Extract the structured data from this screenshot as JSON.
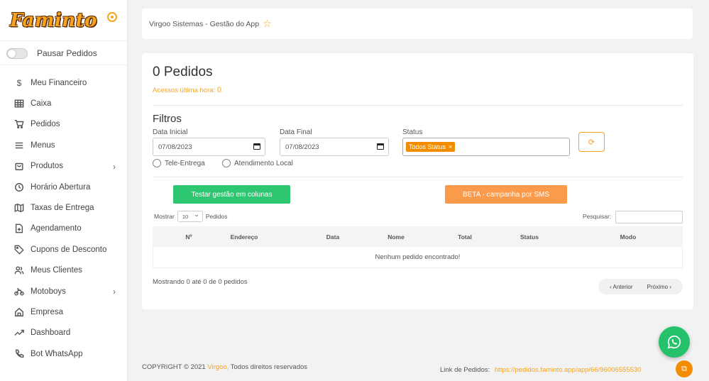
{
  "brand": {
    "logo_text": "Faminto"
  },
  "sidebar": {
    "pause_label": "Pausar Pedidos",
    "items": [
      {
        "label": "Meu Financeiro",
        "icon": "dollar-icon"
      },
      {
        "label": "Caixa",
        "icon": "table-icon"
      },
      {
        "label": "Pedidos",
        "icon": "cart-icon"
      },
      {
        "label": "Menus",
        "icon": "menu-icon"
      },
      {
        "label": "Produtos",
        "icon": "bag-icon",
        "has_submenu": true
      },
      {
        "label": "Horário Abertura",
        "icon": "clock-icon"
      },
      {
        "label": "Taxas de Entrega",
        "icon": "map-icon"
      },
      {
        "label": "Agendamento",
        "icon": "file-plus-icon"
      },
      {
        "label": "Cupons de Desconto",
        "icon": "tag-icon"
      },
      {
        "label": "Meus Clientes",
        "icon": "users-icon"
      },
      {
        "label": "Motoboys",
        "icon": "bike-icon",
        "has_submenu": true
      },
      {
        "label": "Empresa",
        "icon": "home-icon"
      },
      {
        "label": "Dashboard",
        "icon": "trending-icon"
      },
      {
        "label": "Bot WhatsApp",
        "icon": "phone-icon"
      }
    ]
  },
  "header": {
    "breadcrumb": "Virgoo Sistemas - Gestão do App"
  },
  "main": {
    "title": "0 Pedidos",
    "acessos_label": "Acessos última hora:",
    "acessos_value": "0",
    "filters_title": "Filtros",
    "data_inicial_label": "Data Inicial",
    "data_inicial_value": "07/08/2023",
    "data_final_label": "Data Final",
    "data_final_value": "07/08/2023",
    "status_label": "Status",
    "status_tag": "Todos Status",
    "status_tag_remove": "×",
    "refresh_glyph": "⟳",
    "radio_tele": "Tele-Entrega",
    "radio_local": "Atendimento Local",
    "btn_colunas": "Testar gestão em colunas",
    "btn_sms": "BETA - campanha por SMS",
    "mostrar_label": "Mostrar",
    "page_size": "10",
    "pedidos_label": "Pedidos",
    "search_label": "Pesquisar:",
    "table": {
      "columns": [
        "Nº",
        "Endereço",
        "Data",
        "Nome",
        "Total",
        "Status",
        "Modo"
      ],
      "empty_message": "Nenhum pedido encontrado!"
    },
    "info": "Mostrando 0 até 0 de 0 pedidos",
    "prev": "‹ Anterior",
    "next": "Próximo ›"
  },
  "footer": {
    "copyright_prefix": "COPYRIGHT © 2021",
    "company": "Virgoo,",
    "rights": "Todos direitos reservados",
    "link_label": "Link de Pedidos:",
    "link_url": "https://pedidos.faminto.app/app/66/96006555530"
  },
  "colors": {
    "accent": "#f7a41d",
    "green": "#2ec771",
    "orange": "#fb9a4a",
    "whatsapp": "#25c16b"
  }
}
